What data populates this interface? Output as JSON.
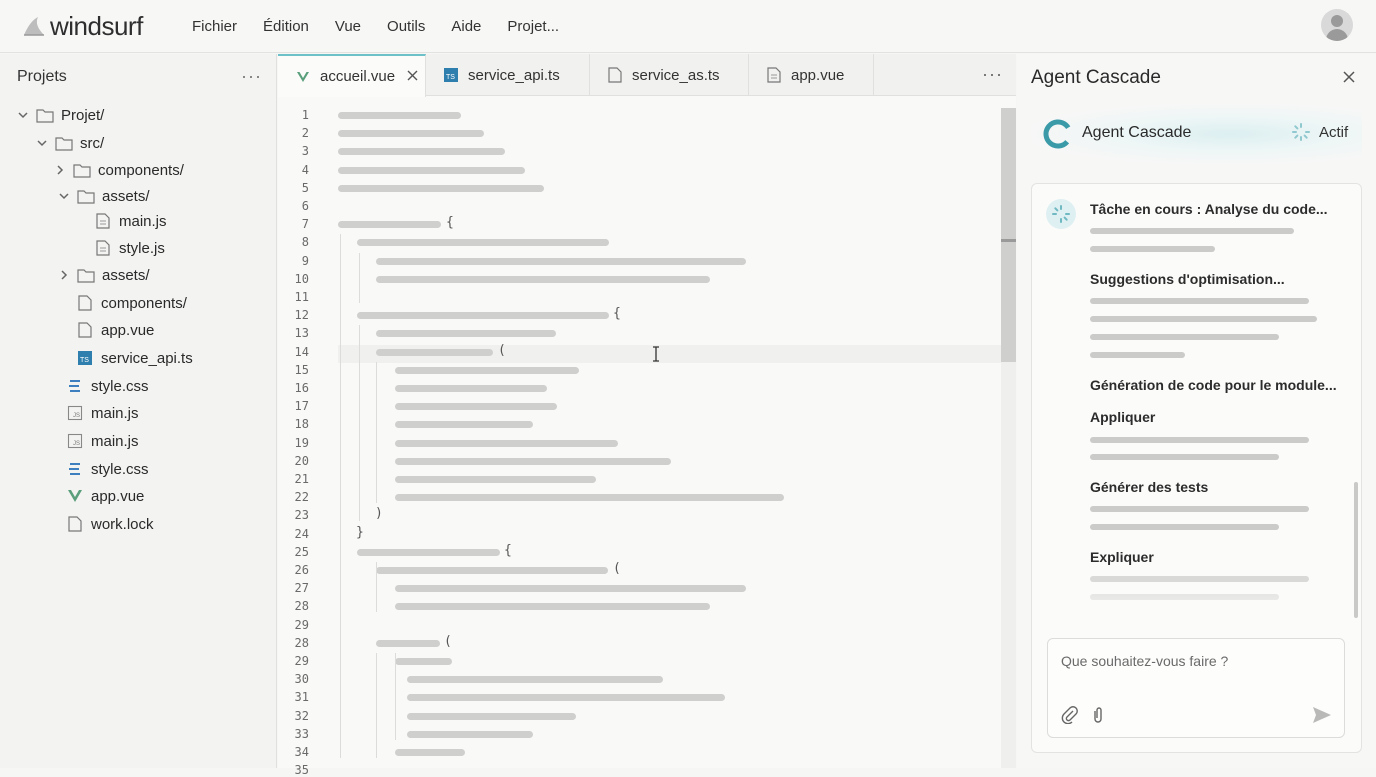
{
  "app": {
    "name": "windsurf"
  },
  "menu": [
    "Fichier",
    "Édition",
    "Vue",
    "Outils",
    "Aide",
    "Projet..."
  ],
  "sidebar": {
    "title": "Projets",
    "tree": [
      {
        "label": "Projet/",
        "type": "folder",
        "expanded": true,
        "icon": "folder-icon"
      },
      {
        "label": "src/",
        "type": "folder",
        "expanded": true,
        "icon": "folder-icon"
      },
      {
        "label": "components/",
        "type": "folder",
        "expanded": false,
        "icon": "folder-icon"
      },
      {
        "label": "assets/",
        "type": "folder",
        "expanded": true,
        "icon": "folder-icon"
      },
      {
        "label": "main.js",
        "type": "file",
        "icon": "document-icon"
      },
      {
        "label": "style.js",
        "type": "file",
        "icon": "document-icon"
      },
      {
        "label": "assets/",
        "type": "folder",
        "expanded": false,
        "icon": "folder-icon"
      },
      {
        "label": "components/",
        "type": "file",
        "icon": "file-icon"
      },
      {
        "label": "app.vue",
        "type": "file",
        "icon": "file-icon"
      },
      {
        "label": "service_api.ts",
        "type": "file",
        "icon": "typescript-icon"
      },
      {
        "label": "style.css",
        "type": "file",
        "icon": "css-icon"
      },
      {
        "label": "main.js",
        "type": "file",
        "icon": "js-icon"
      },
      {
        "label": "main.js",
        "type": "file",
        "icon": "js-icon"
      },
      {
        "label": "style.css",
        "type": "file",
        "icon": "css-icon"
      },
      {
        "label": "app.vue",
        "type": "file",
        "icon": "vue-icon"
      },
      {
        "label": "work.lock",
        "type": "file",
        "icon": "file-icon"
      }
    ]
  },
  "editor": {
    "tabs": [
      {
        "label": "accueil.vue",
        "icon": "vue-icon",
        "active": true
      },
      {
        "label": "service_api.ts",
        "icon": "typescript-icon",
        "active": false
      },
      {
        "label": "service_as.ts",
        "icon": "file-icon",
        "active": false
      },
      {
        "label": "app.vue",
        "icon": "document-icon",
        "active": false
      }
    ],
    "line_numbers": [
      "1",
      "2",
      "3",
      "4",
      "5",
      "6",
      "7",
      "8",
      "9",
      "10",
      "11",
      "12",
      "13",
      "14",
      "15",
      "16",
      "17",
      "18",
      "19",
      "20",
      "21",
      "22",
      "23",
      "24",
      "25",
      "26",
      "27",
      "28",
      "29",
      "28",
      "29",
      "30",
      "31",
      "32",
      "33",
      "34",
      "35"
    ],
    "braces": {
      "open_curly": "{",
      "close_curly": "}",
      "open_paren": "(",
      "close_paren": ")"
    }
  },
  "agent": {
    "title": "Agent Cascade",
    "name": "Agent Cascade",
    "status": "Actif",
    "sections": [
      {
        "title": "Tâche en cours : Analyse du code..."
      },
      {
        "title": "Suggestions d'optimisation..."
      },
      {
        "title": "Génération de code pour le module..."
      },
      {
        "title": "Appliquer"
      },
      {
        "title": "Générer des tests"
      },
      {
        "title": "Expliquer"
      }
    ],
    "input_placeholder": "Que souhaitez-vous faire ?",
    "accent_color": "#3a9aa8"
  }
}
